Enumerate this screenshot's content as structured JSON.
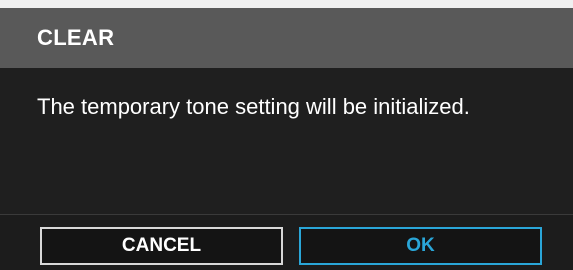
{
  "dialog": {
    "title": "CLEAR",
    "message": "The temporary tone setting will be initialized.",
    "buttons": {
      "cancel_label": "CANCEL",
      "ok_label": "OK"
    },
    "colors": {
      "title_bar": "#595959",
      "background": "#1f1f1f",
      "ok_accent": "#2aa6d8",
      "cancel_border": "#d8d8d8",
      "text": "#ffffff"
    }
  }
}
